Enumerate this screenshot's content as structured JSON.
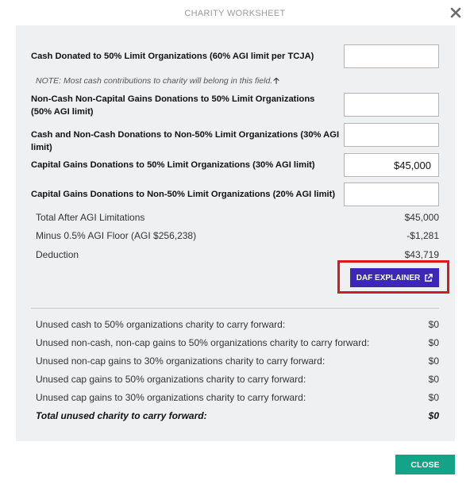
{
  "dialog": {
    "title": "CHARITY WORKSHEET",
    "close_label": "CLOSE"
  },
  "fields": [
    {
      "label": "Cash Donated to 50% Limit Organizations (60% AGI limit per TCJA)",
      "value": ""
    },
    {
      "label": "Non-Cash Non-Capital Gains Donations to 50% Limit Organizations (50% AGI limit)",
      "value": ""
    },
    {
      "label": "Cash and Non-Cash Donations to Non-50% Limit Organizations (30% AGI limit)",
      "value": ""
    },
    {
      "label": "Capital Gains Donations to 50% Limit Organizations (30% AGI limit)",
      "value": "$45,000"
    },
    {
      "label": "Capital Gains Donations to Non-50% Limit Organizations (20% AGI limit)",
      "value": ""
    }
  ],
  "note": "NOTE: Most cash contributions to charity will belong in this field.",
  "summary": [
    {
      "label": "Total After AGI Limitations",
      "value": "$45,000"
    },
    {
      "label": "Minus 0.5% AGI Floor (AGI $256,238)",
      "value": "-$1,281"
    },
    {
      "label": "Deduction",
      "value": "$43,719"
    }
  ],
  "daf_button": {
    "label": "DAF EXPLAINER",
    "icon": "external-link-icon"
  },
  "carry_forward": [
    {
      "label": "Unused cash to 50% organizations charity to carry forward:",
      "value": "$0"
    },
    {
      "label": "Unused non-cash, non-cap gains to 50% organizations charity to carry forward:",
      "value": "$0"
    },
    {
      "label": "Unused non-cap gains to 30% organizations charity to carry forward:",
      "value": "$0"
    },
    {
      "label": "Unused cap gains to 50% organizations charity to carry forward:",
      "value": "$0"
    },
    {
      "label": "Unused cap gains to 30% organizations charity to carry forward:",
      "value": "$0"
    },
    {
      "label": "Total unused charity to carry forward:",
      "value": "$0"
    }
  ],
  "colors": {
    "panel_bg": "#eef0f2",
    "daf_button": "#3c27b8",
    "highlight": "#d71920",
    "close_button": "#13a387"
  }
}
